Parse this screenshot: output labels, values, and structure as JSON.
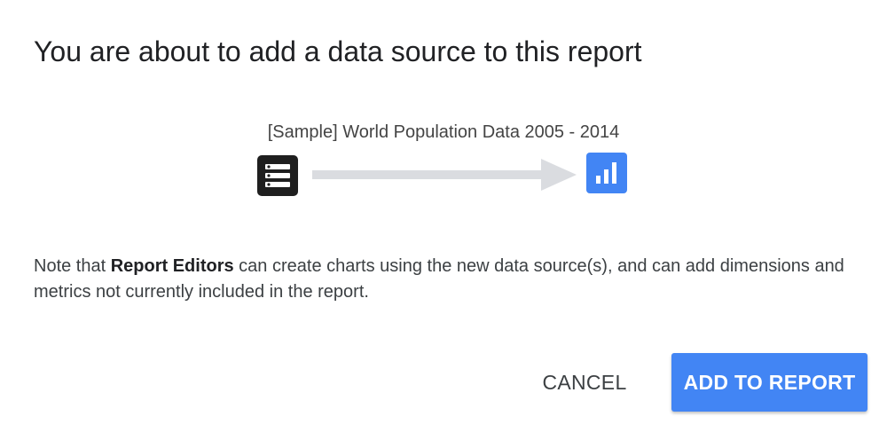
{
  "dialog": {
    "title": "You are about to add a data source to this report",
    "source_name": "[Sample] World Population Data 2005 - 2014",
    "source_icon": "database-list-icon",
    "arrow_icon": "arrow-right-icon",
    "target_icon": "bar-chart-icon",
    "note": {
      "before": "Note that ",
      "bold": "Report Editors",
      "after": " can create charts using the new data source(s), and can add dimensions and metrics not currently included in the report."
    },
    "buttons": {
      "cancel_label": "CANCEL",
      "add_label": "ADD TO REPORT"
    }
  },
  "colors": {
    "accent": "#4285f4",
    "source_icon_bg": "#1f1f1f",
    "arrow": "#dadce0"
  }
}
